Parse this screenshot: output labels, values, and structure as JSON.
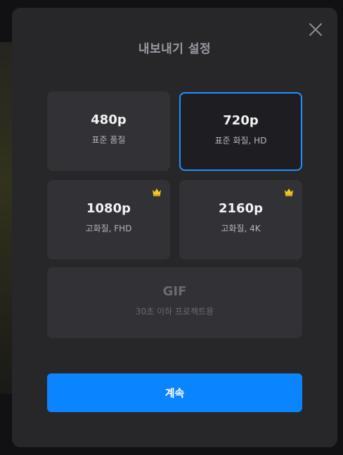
{
  "dialog": {
    "title": "내보내기 설정",
    "continue_label": "계속"
  },
  "options": [
    {
      "label": "480p",
      "sub": "표준 품질",
      "selected": false,
      "premium": false,
      "disabled": false
    },
    {
      "label": "720p",
      "sub": "표준 화질, HD",
      "selected": true,
      "premium": false,
      "disabled": false
    },
    {
      "label": "1080p",
      "sub": "고화질, FHD",
      "selected": false,
      "premium": true,
      "disabled": false
    },
    {
      "label": "2160p",
      "sub": "고화질, 4K",
      "selected": false,
      "premium": true,
      "disabled": false
    },
    {
      "label": "GIF",
      "sub": "30초 이하 프로젝트용",
      "selected": false,
      "premium": false,
      "disabled": true
    }
  ],
  "icons": {
    "close": "close-icon",
    "premium": "crown-icon"
  },
  "colors": {
    "accent": "#0a84ff",
    "crown": "#f5c518",
    "panel": "#27272a"
  }
}
